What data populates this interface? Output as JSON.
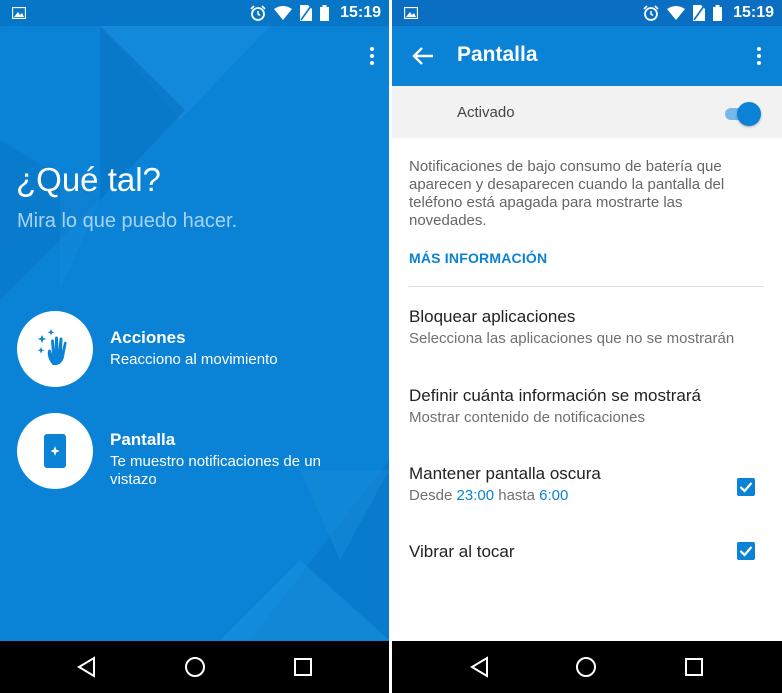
{
  "status_bar": {
    "time": "15:19"
  },
  "left": {
    "greeting": "¿Qué tal?",
    "subtitle": "Mira lo que puedo hacer.",
    "features": [
      {
        "title": "Acciones",
        "desc": "Reacciono al movimiento"
      },
      {
        "title": "Pantalla",
        "desc": "Te muestro notificaciones de un vistazo"
      }
    ]
  },
  "right": {
    "title": "Pantalla",
    "activated_label": "Activado",
    "switch_on": true,
    "description": "Notificaciones de bajo consumo de batería que aparecen y desaparecen cuando la pantalla del teléfono está apagada para mostrarte las novedades.",
    "more_info": "MÁS INFORMACIÓN",
    "settings": {
      "block": {
        "title": "Bloquear aplicaciones",
        "subtitle": "Selecciona las aplicaciones que no se mostrarán"
      },
      "define": {
        "title": "Definir cuánta información se mostrará",
        "subtitle": "Mostrar contenido de notificaciones"
      },
      "dark": {
        "title": "Mantener pantalla oscura",
        "from_label": "Desde",
        "from": "23:00",
        "to_label": "hasta",
        "to": "6:00",
        "checked": true
      },
      "vibrate": {
        "title": "Vibrar al tocar",
        "checked": true
      }
    }
  },
  "colors": {
    "accent": "#0a82d6",
    "left_bg": "#0a82d6"
  }
}
